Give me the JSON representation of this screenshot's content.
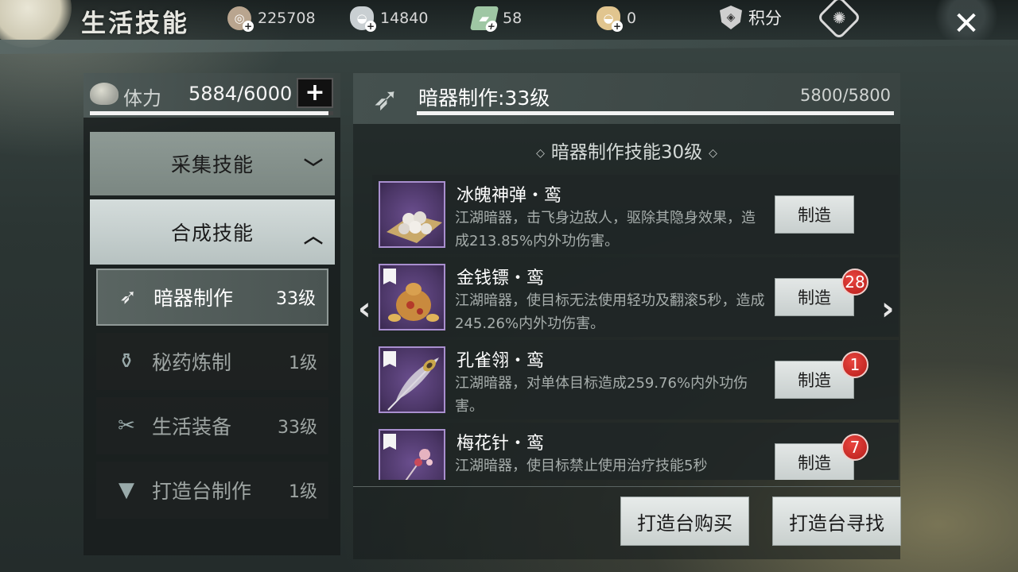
{
  "header": {
    "title": "生活技能",
    "currencies": [
      {
        "icon": "coin-pouch-icon",
        "value": "225708"
      },
      {
        "icon": "silver-ingot-icon",
        "value": "14840"
      },
      {
        "icon": "jade-ticket-icon",
        "value": "58"
      },
      {
        "icon": "gold-ingot-icon",
        "value": "0"
      }
    ],
    "points_label": "积分"
  },
  "stamina": {
    "label": "体力",
    "value": "5884/6000",
    "current": 5884,
    "max": 6000
  },
  "categories": {
    "collect": "采集技能",
    "synth": "合成技能"
  },
  "skills": [
    {
      "name": "暗器制作",
      "level": "33级",
      "icon": "dart-icon",
      "active": true
    },
    {
      "name": "秘药炼制",
      "level": "1级",
      "icon": "potion-icon",
      "active": false
    },
    {
      "name": "生活装备",
      "level": "33级",
      "icon": "scissors-icon",
      "active": false
    },
    {
      "name": "打造台制作",
      "level": "1级",
      "icon": "anvil-icon",
      "active": false
    }
  ],
  "detail": {
    "title": "暗器制作:33级",
    "exp": "5800/5800",
    "exp_current": 5800,
    "exp_max": 5800,
    "level_caption": "暗器制作技能30级"
  },
  "recipes": [
    {
      "name": "冰魄神弹・鸾",
      "desc": "江湖暗器，击飞身边敌人，驱除其隐身效果，造成213.85%内外功伤害。",
      "button": "制造",
      "badge": ""
    },
    {
      "name": "金钱镖・鸾",
      "desc": "江湖暗器，使目标无法使用轻功及翻滚5秒，造成245.26%内外功伤害。",
      "button": "制造",
      "badge": "28"
    },
    {
      "name": "孔雀翎・鸾",
      "desc": "江湖暗器，对单体目标造成259.76%内外功伤害。",
      "button": "制造",
      "badge": "1"
    },
    {
      "name": "梅花针・鸾",
      "desc": "江湖暗器，使目标禁止使用治疗技能5秒",
      "button": "制造",
      "badge": "7"
    }
  ],
  "buttons": {
    "buy": "打造台购买",
    "find": "打造台寻找"
  },
  "colors": {
    "accent_light": "#d4dcdb",
    "badge_red": "#d8302b",
    "item_frame_purple": "#a98fcf"
  }
}
